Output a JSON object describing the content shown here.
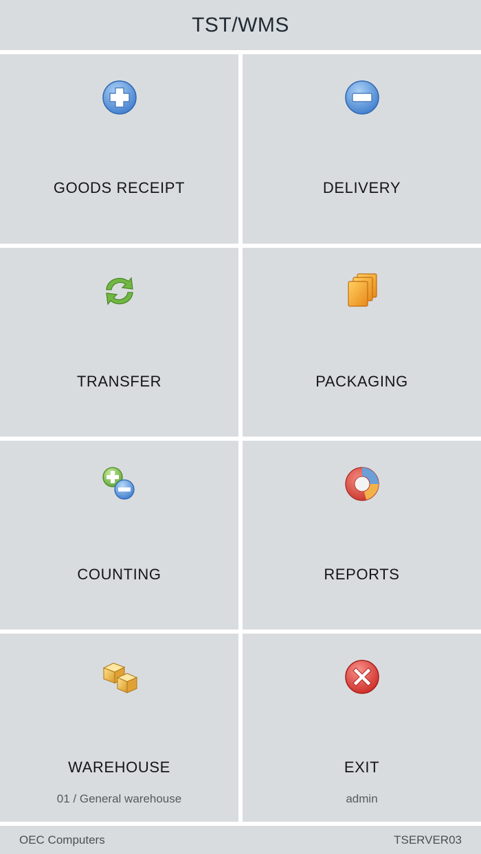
{
  "app": {
    "title": "TST/WMS"
  },
  "menu": {
    "goods_receipt": {
      "label": "GOODS RECEIPT",
      "icon": "plus-circle-icon"
    },
    "delivery": {
      "label": "DELIVERY",
      "icon": "minus-circle-icon"
    },
    "transfer": {
      "label": "TRANSFER",
      "icon": "refresh-arrows-icon"
    },
    "packaging": {
      "label": "PACKAGING",
      "icon": "stacked-boxes-icon"
    },
    "counting": {
      "label": "COUNTING",
      "icon": "plus-minus-icon"
    },
    "reports": {
      "label": "REPORTS",
      "icon": "pie-chart-icon"
    },
    "warehouse": {
      "label": "WAREHOUSE",
      "sub": "01 / General warehouse",
      "icon": "cardboard-boxes-icon"
    },
    "exit": {
      "label": "EXIT",
      "sub": "admin",
      "icon": "close-circle-icon"
    }
  },
  "footer": {
    "company": "OEC Computers",
    "server": "TSERVER03"
  },
  "colors": {
    "tile_bg": "#d9dcdf",
    "divider": "#ffffff",
    "blue_icon": "#5b95d6",
    "green_icon": "#6bb03f",
    "orange_icon": "#f0a020",
    "red_icon": "#d9302b"
  }
}
